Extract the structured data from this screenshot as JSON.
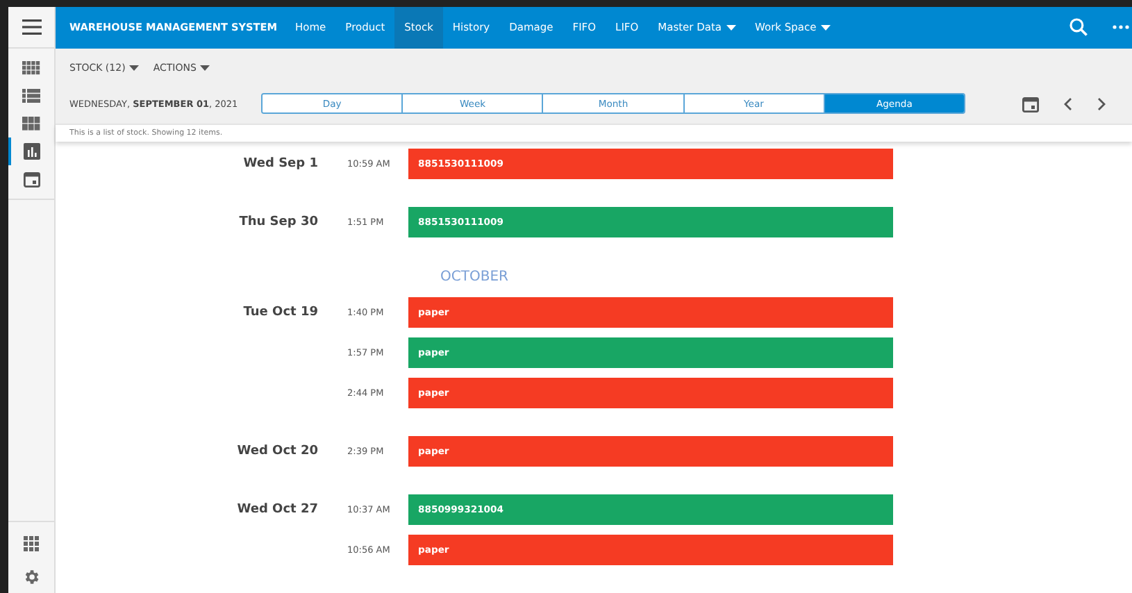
{
  "app_title": "WAREHOUSE MANAGEMENT SYSTEM",
  "nav": [
    {
      "label": "Home",
      "selected": false,
      "dropdown": false
    },
    {
      "label": "Product",
      "selected": false,
      "dropdown": false
    },
    {
      "label": "Stock",
      "selected": true,
      "dropdown": false
    },
    {
      "label": "History",
      "selected": false,
      "dropdown": false
    },
    {
      "label": "Damage",
      "selected": false,
      "dropdown": false
    },
    {
      "label": "FIFO",
      "selected": false,
      "dropdown": false
    },
    {
      "label": "LIFO",
      "selected": false,
      "dropdown": false
    },
    {
      "label": "Master Data",
      "selected": false,
      "dropdown": true
    },
    {
      "label": "Work Space",
      "selected": false,
      "dropdown": true
    }
  ],
  "sidebar": {
    "items": [
      {
        "kind": "grid",
        "selected": false
      },
      {
        "kind": "list",
        "selected": false
      },
      {
        "kind": "tiles",
        "selected": false
      },
      {
        "kind": "chart",
        "selected": true
      },
      {
        "kind": "calendar",
        "selected": false
      }
    ],
    "bottom": [
      {
        "kind": "apps"
      },
      {
        "kind": "settings"
      }
    ]
  },
  "toolbar": {
    "menus": [
      "STOCK (12)",
      "ACTIONS"
    ],
    "date_prefix": "WEDNESDAY, ",
    "date_bold": "SEPTEMBER 01",
    "date_suffix": ", 2021",
    "views": [
      {
        "label": "Day",
        "selected": false
      },
      {
        "label": "Week",
        "selected": false
      },
      {
        "label": "Month",
        "selected": false
      },
      {
        "label": "Year",
        "selected": false
      },
      {
        "label": "Agenda",
        "selected": true
      }
    ]
  },
  "info": "This is a list of stock. Showing 12 items.",
  "agenda": [
    {
      "kind": "day",
      "date": "Wed Sep 1",
      "events": [
        {
          "time": "10:59 AM",
          "label": "8851530111009",
          "color": "#f53b23"
        }
      ]
    },
    {
      "kind": "day",
      "date": "Thu Sep 30",
      "events": [
        {
          "time": "1:51 PM",
          "label": "8851530111009",
          "color": "#18a664"
        }
      ]
    },
    {
      "kind": "month",
      "label": "OCTOBER"
    },
    {
      "kind": "day",
      "date": "Tue Oct 19",
      "events": [
        {
          "time": "1:40 PM",
          "label": "paper",
          "color": "#f53b23"
        },
        {
          "time": "1:57 PM",
          "label": "paper",
          "color": "#18a664"
        },
        {
          "time": "2:44 PM",
          "label": "paper",
          "color": "#f53b23"
        }
      ]
    },
    {
      "kind": "day",
      "date": "Wed Oct 20",
      "events": [
        {
          "time": "2:39 PM",
          "label": "paper",
          "color": "#f53b23"
        }
      ]
    },
    {
      "kind": "day",
      "date": "Wed Oct 27",
      "events": [
        {
          "time": "10:37 AM",
          "label": "8850999321004",
          "color": "#18a664"
        },
        {
          "time": "10:56 AM",
          "label": "paper",
          "color": "#f53b23"
        }
      ]
    }
  ]
}
